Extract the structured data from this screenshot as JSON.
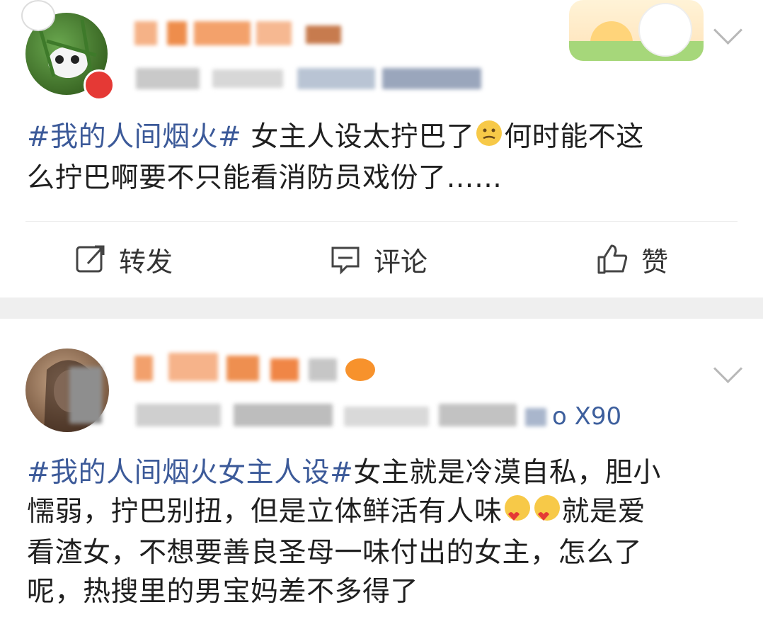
{
  "post1": {
    "hashtag": "#我的人间烟火#",
    "text_part1": "女主人设太拧巴了",
    "emoji1": "smirk-emoji",
    "text_part2": "何时能不这",
    "text_line2": "么拧巴啊要不只能看消防员戏份了……",
    "actions": {
      "repost": "转发",
      "comment": "评论",
      "like": "赞"
    }
  },
  "post2": {
    "meta_suffix": "o X90",
    "hashtag": "#我的人间烟火女主人设#",
    "line1_rest": "女主就是冷漠自私，胆小",
    "line2_text": "懦弱，拧巴别扭，但是立体鲜活有人味",
    "emoji": "heart-emoji",
    "line2_rest": "就是爱",
    "line3": "看渣女，不想要善良圣母一味付出的女主，怎么了",
    "line4": "呢，热搜里的男宝妈差不多得了"
  },
  "colors": {
    "hashtag": "#3c5a99",
    "separator": "#efefef",
    "text": "#1f1f1f"
  }
}
